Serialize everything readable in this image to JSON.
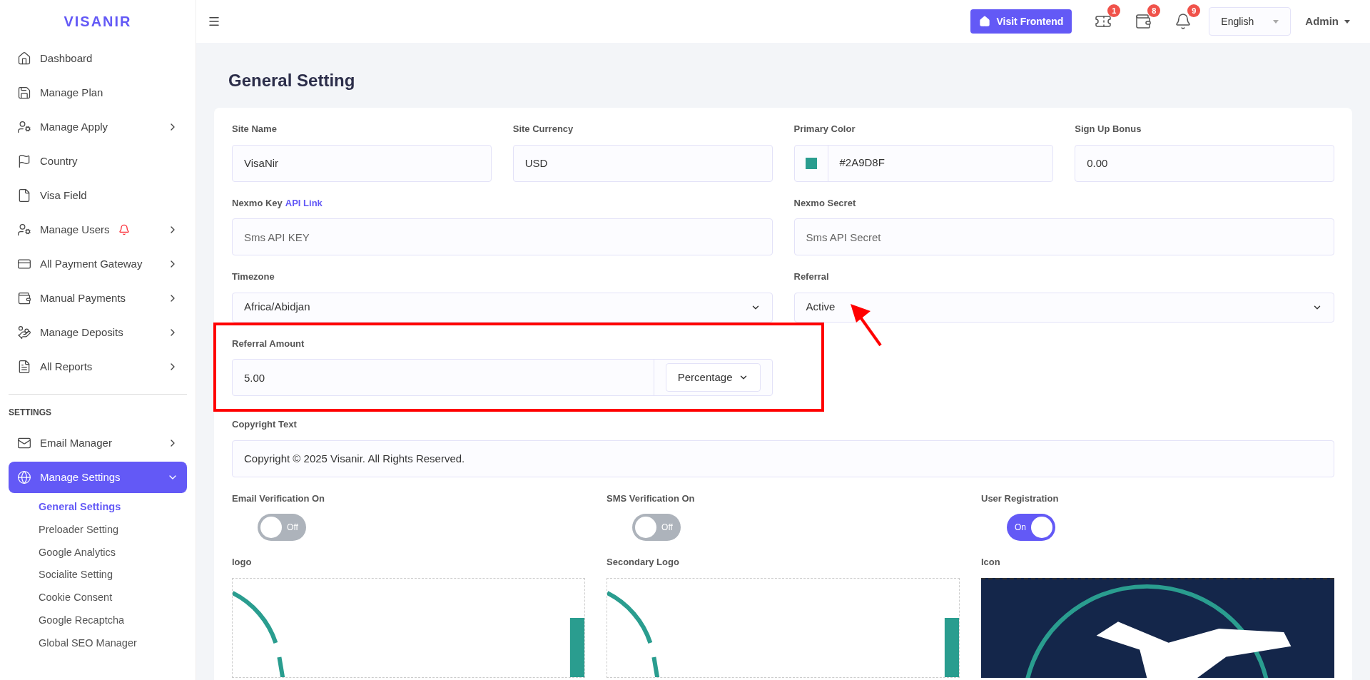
{
  "brand": "VISANIR",
  "topbar": {
    "visit_button": "Visit Frontend",
    "language": "English",
    "user": "Admin",
    "badges": [
      {
        "kind": "ticket",
        "count": "1"
      },
      {
        "kind": "wallet",
        "count": "8"
      },
      {
        "kind": "bell",
        "count": "9"
      }
    ]
  },
  "sidebar": {
    "items": [
      {
        "label": "Dashboard",
        "kind": "home",
        "has_submenu": false,
        "alert": false
      },
      {
        "label": "Manage Plan",
        "kind": "plan",
        "has_submenu": false,
        "alert": false
      },
      {
        "label": "Manage Apply",
        "kind": "usergear",
        "has_submenu": true,
        "alert": false
      },
      {
        "label": "Country",
        "kind": "flag",
        "has_submenu": false,
        "alert": false
      },
      {
        "label": "Visa Field",
        "kind": "file",
        "has_submenu": false,
        "alert": false
      },
      {
        "label": "Manage Users",
        "kind": "usergear",
        "has_submenu": true,
        "alert": true
      },
      {
        "label": "All Payment Gateway",
        "kind": "card",
        "has_submenu": true,
        "alert": false
      },
      {
        "label": "Manual Payments",
        "kind": "wallet",
        "has_submenu": true,
        "alert": false
      },
      {
        "label": "Manage Deposits",
        "kind": "deposit",
        "has_submenu": true,
        "alert": false
      },
      {
        "label": "All Reports",
        "kind": "report",
        "has_submenu": true,
        "alert": false
      }
    ],
    "section_title": "SETTINGS",
    "settings_items": [
      {
        "label": "Email Manager",
        "kind": "mail",
        "has_submenu": true,
        "selected": false,
        "expanded": false
      },
      {
        "label": "Manage Settings",
        "kind": "globe",
        "has_submenu": true,
        "selected": true,
        "expanded": true,
        "children": [
          {
            "label": "General Settings",
            "selected": true
          },
          {
            "label": "Preloader Setting",
            "selected": false
          },
          {
            "label": "Google Analytics",
            "selected": false
          },
          {
            "label": "Socialite Setting",
            "selected": false
          },
          {
            "label": "Cookie Consent",
            "selected": false
          },
          {
            "label": "Google Recaptcha",
            "selected": false
          },
          {
            "label": "Global SEO Manager",
            "selected": false
          }
        ]
      }
    ]
  },
  "page_title": "General Setting",
  "form": {
    "rows": [
      [
        {
          "kind": "text",
          "label": "Site Name",
          "value": "VisaNir"
        },
        {
          "kind": "text",
          "label": "Site Currency",
          "value": "USD"
        },
        {
          "kind": "color",
          "label": "Primary Color",
          "value": "#2A9D8F",
          "color": "#2a9d8f"
        },
        {
          "kind": "text",
          "label": "Sign Up Bonus",
          "value": "0.00"
        }
      ],
      [
        {
          "kind": "text",
          "label": "Nexmo Key",
          "link": "API Link",
          "placeholder": "Sms API KEY"
        },
        {
          "kind": "text",
          "label": "Nexmo Secret",
          "placeholder": "Sms API Secret"
        }
      ],
      [
        {
          "kind": "select",
          "label": "Timezone",
          "value": "Africa/Abidjan"
        },
        {
          "kind": "select",
          "label": "Referral",
          "value": "Active"
        }
      ],
      [
        {
          "kind": "amount",
          "label": "Referral Amount",
          "value": "5.00",
          "unit": "Percentage"
        }
      ],
      [
        {
          "kind": "wide",
          "label": "Copyright Text",
          "value": "Copyright © 2025 Visanir. All Rights Reserved."
        }
      ]
    ],
    "toggles": [
      {
        "label": "Email Verification On",
        "on": false,
        "text": "Off"
      },
      {
        "label": "SMS Verification On",
        "on": false,
        "text": "Off"
      },
      {
        "label": "User Registration",
        "on": true,
        "text": "On"
      }
    ],
    "images": [
      {
        "label": "logo",
        "kind": "logo"
      },
      {
        "label": "Secondary Logo",
        "kind": "logo"
      },
      {
        "label": "Icon",
        "kind": "icon"
      }
    ]
  }
}
